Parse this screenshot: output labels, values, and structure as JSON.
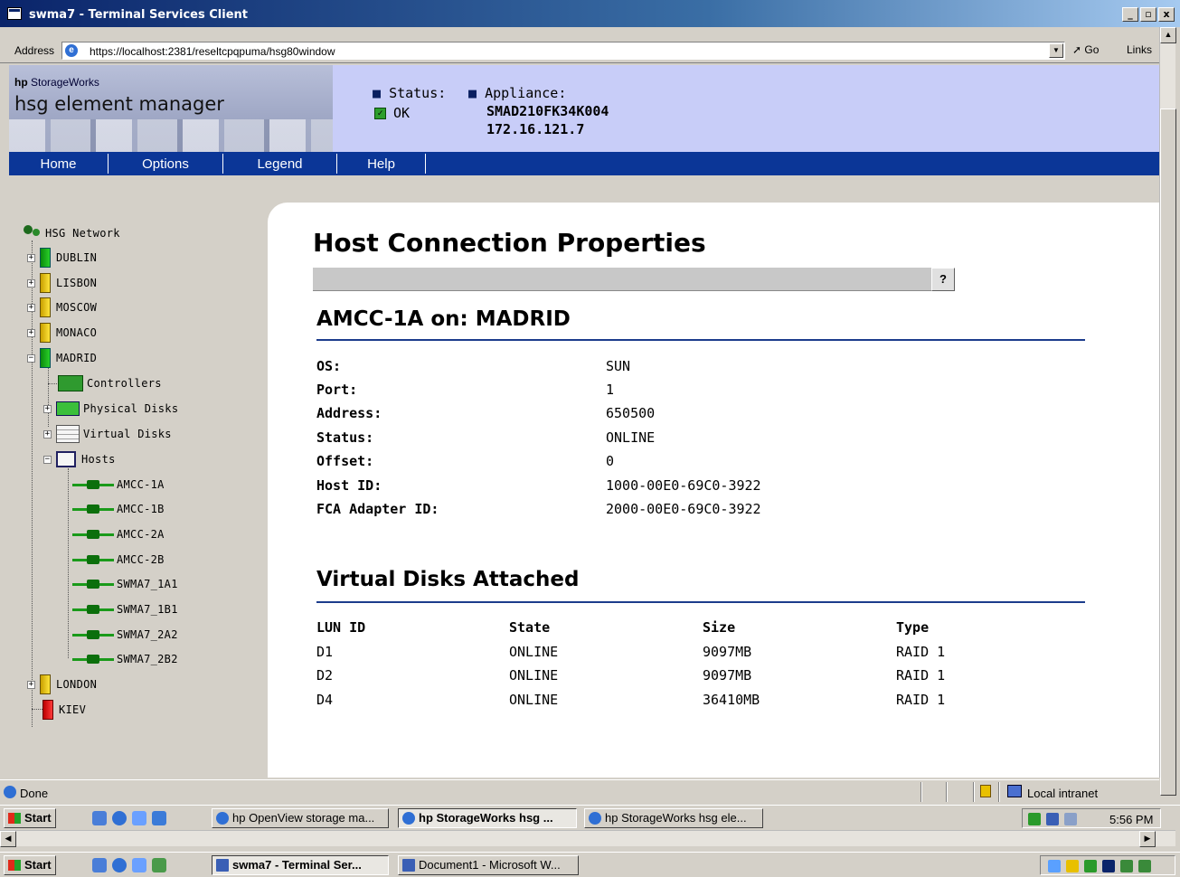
{
  "window": {
    "title": "swma7 - Terminal Services Client",
    "min_glyph": "_",
    "max_glyph": "▫",
    "close_glyph": "x"
  },
  "browser": {
    "address_label": "Address",
    "url": "https://localhost:2381/reseltcpqpuma/hsg80window",
    "go_label": "Go",
    "links_label": "Links"
  },
  "header": {
    "brand_hp": "hp",
    "brand_name": "StorageWorks",
    "product": "hsg element manager",
    "status_label": "Status:",
    "status_value": "OK",
    "appliance_label": "Appliance:",
    "appliance_id": "SMAD210FK34K004",
    "appliance_ip": "172.16.121.7"
  },
  "nav": {
    "home": "Home",
    "options": "Options",
    "legend": "Legend",
    "help": "Help"
  },
  "tree": {
    "root": "HSG Network",
    "nodes": {
      "dublin": "DUBLIN",
      "lisbon": "LISBON",
      "moscow": "MOSCOW",
      "monaco": "MONACO",
      "madrid": "MADRID",
      "controllers": "Controllers",
      "physical_disks": "Physical Disks",
      "virtual_disks": "Virtual Disks",
      "hosts": "Hosts",
      "london": "LONDON",
      "kiev": "KIEV"
    },
    "hosts": [
      "AMCC-1A",
      "AMCC-1B",
      "AMCC-2A",
      "AMCC-2B",
      "SWMA7_1A1",
      "SWMA7_1B1",
      "SWMA7_2A2",
      "SWMA7_2B2"
    ]
  },
  "content": {
    "page_title": "Host Connection Properties",
    "help_label": "?",
    "connection_title": "AMCC-1A on:  MADRID",
    "properties": [
      {
        "label": "OS:",
        "value": "SUN"
      },
      {
        "label": "Port:",
        "value": "1"
      },
      {
        "label": "Address:",
        "value": "650500"
      },
      {
        "label": "Status:",
        "value": "ONLINE"
      },
      {
        "label": "Offset:",
        "value": "0"
      },
      {
        "label": "Host ID:",
        "value": "1000-00E0-69C0-3922"
      },
      {
        "label": "FCA Adapter ID:",
        "value": "2000-00E0-69C0-3922"
      }
    ],
    "vdisks_title": "Virtual Disks Attached",
    "vdisks_columns": [
      "LUN ID",
      "State",
      "Size",
      "Type"
    ],
    "vdisks_rows": [
      [
        "D1",
        "ONLINE",
        "9097MB",
        "RAID 1"
      ],
      [
        "D2",
        "ONLINE",
        "9097MB",
        "RAID 1"
      ],
      [
        "D4",
        "ONLINE",
        "36410MB",
        "RAID 1"
      ]
    ]
  },
  "ie_status": {
    "done": "Done",
    "zone": "Local intranet"
  },
  "taskbar_inner": {
    "start": "Start",
    "tasks": [
      "hp OpenView storage ma...",
      "hp StorageWorks hsg ...",
      "hp StorageWorks hsg ele..."
    ],
    "clock": "5:56 PM"
  },
  "taskbar_outer": {
    "start": "Start",
    "tasks": [
      "swma7 - Terminal Ser...",
      "Document1 - Microsoft W..."
    ]
  },
  "colors": {
    "nav_blue": "#0b3697",
    "header_lavender": "#c8cdf8",
    "rule_blue": "#1c3c8c",
    "ok_green": "#2d9e2d"
  }
}
